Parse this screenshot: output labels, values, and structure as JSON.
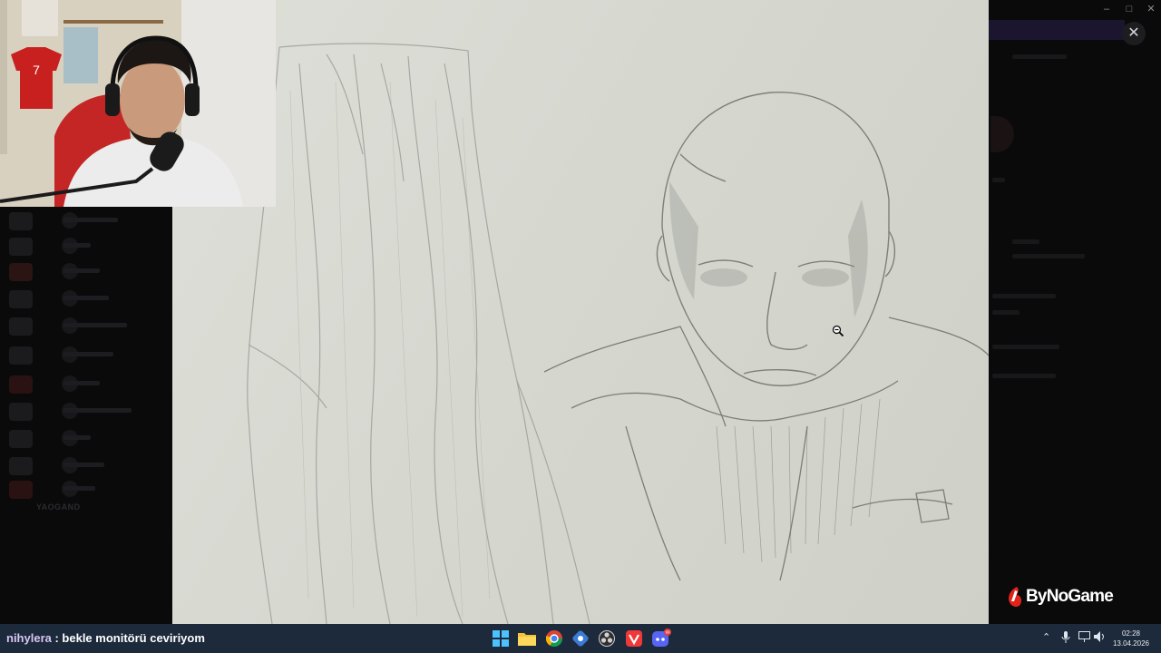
{
  "chat_message": {
    "username": "nihylera",
    "separator": " : ",
    "text": "bekle monitörü ceviriyom"
  },
  "watermark": {
    "brand": "ByNoGame"
  },
  "window": {
    "close_icon": "close-icon"
  },
  "sidebar_background": {
    "section_heading": "YAOGAND"
  },
  "taskbar": {
    "apps": [
      "windows-start-icon",
      "file-explorer-icon",
      "chrome-icon",
      "app-icon",
      "obs-icon",
      "vivaldi-icon",
      "discord-icon"
    ],
    "discord_badge": "99",
    "tray_icons": [
      "chevron-up-icon",
      "microphone-icon",
      "network-icon",
      "volume-icon"
    ],
    "time": "02:28",
    "date": "13.04.2026"
  },
  "colors": {
    "taskbar_bg": "#1d2a3b",
    "username": "#d8c7f5",
    "brand_red": "#e2231a"
  }
}
